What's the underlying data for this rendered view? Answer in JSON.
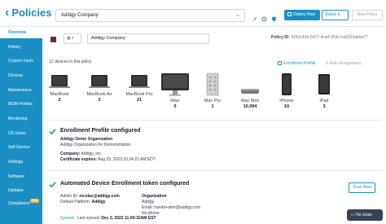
{
  "header": {
    "title": "Policies",
    "policy_select": "Addigy Company",
    "deploy_label": "Deploy Now",
    "status_label": "Status",
    "new_policy_label": "New Policy"
  },
  "sidebar": {
    "items": [
      {
        "label": "Overview",
        "active": true
      },
      {
        "label": "History"
      },
      {
        "label": "Custom Facts"
      },
      {
        "label": "Devices"
      },
      {
        "label": "Maintenance"
      },
      {
        "label": "MDM Profiles"
      },
      {
        "label": "Monitoring"
      },
      {
        "label": "OS Users"
      },
      {
        "label": "Self Service"
      },
      {
        "label": "Settings"
      },
      {
        "label": "Software"
      },
      {
        "label": "Updates"
      },
      {
        "label": "Compliance",
        "badge": "Beta"
      }
    ]
  },
  "policy": {
    "color": "#8b1e1e",
    "name": "Addigy Company",
    "id_label": "Policy ID:",
    "id_value": "4161c434-5477-4ca4-953c-ca5253ab6a77"
  },
  "devices_summary": "12 devices in this policy",
  "links": {
    "enrollment_profile": "Enrollment Profile",
    "auto_assignment": "Auto-Assignment..."
  },
  "devices": [
    {
      "name": "MacBook",
      "count": "2",
      "icon": "macbook-icon"
    },
    {
      "name": "MacBook Air",
      "count": "3",
      "icon": "macbook-air-icon"
    },
    {
      "name": "MacBook Pro",
      "count": "21",
      "icon": "macbook-pro-icon"
    },
    {
      "name": "iMac",
      "count": "5",
      "icon": "imac-icon"
    },
    {
      "name": "Mac Pro",
      "count": "1",
      "icon": "mac-pro-icon"
    },
    {
      "name": "Mac Mini",
      "count": "10,094",
      "icon": "mac-mini-icon"
    },
    {
      "name": "iPhone",
      "count": "10",
      "icon": "iphone-icon"
    },
    {
      "name": "iPad",
      "count": "3",
      "icon": "ipad-icon"
    }
  ],
  "enrollment": {
    "title": "Enrollment Profile configured",
    "org": "Addigy Demo Organization",
    "org_desc": "Addigy Organization for Demonstration.",
    "company_label": "Company:",
    "company_value": "Addigy, Inc.",
    "cert_label": "Certificate expires:",
    "cert_value": "Aug 23, 2023 10:24:22 AM EDT"
  },
  "ade": {
    "title": "Automated Device Enrollment token configured",
    "admin_label": "Admin ID:",
    "admin_value": "nicolas@addigy.com",
    "platform_label": "Default Platform:",
    "platform_value": "Addigy",
    "org_label": "Organization",
    "org_value": "Addigy",
    "email_label": "Email:",
    "email_value": "harold+abm@addigy.com",
    "phone_label": "No phone",
    "synced_label": "Synced",
    "last_synced_label": "Last synced:",
    "last_synced_value": "Dec 2, 2022 11:00:32AM EST",
    "scan_label": "Scan Now"
  },
  "chat_label": "No chats",
  "colors": {
    "accent": "#1b8fc4",
    "success": "#16a34a",
    "beta": "#f6b93b"
  }
}
